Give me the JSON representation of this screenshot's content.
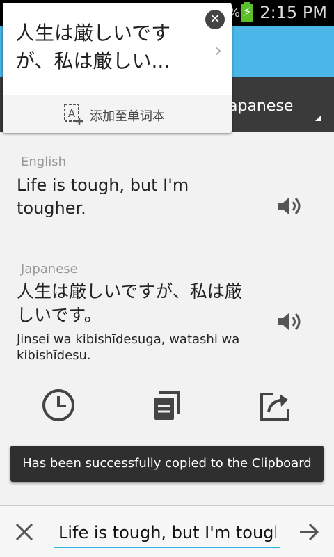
{
  "status_bar": {
    "battery_pct": "%",
    "time": "2:15 PM"
  },
  "popup": {
    "text": "人生は厳しいですが、私は厳しい...",
    "add_to_wordbook": "添加至单词本"
  },
  "language_selector": {
    "target_language": "apanese"
  },
  "source": {
    "label": "English",
    "text": "Life is tough, but I'm tougher."
  },
  "translation": {
    "label": "Japanese",
    "text": "人生は厳しいですが、私は厳しいです。",
    "romanization": "Jinsei wa kibishīdesuga, watashi wa kibishīdesu."
  },
  "toast": {
    "message": "Has been successfully copied to the Clipboard"
  },
  "input": {
    "value": "Life is tough, but I'm tougher."
  },
  "colors": {
    "accent": "#33b5e5",
    "app_bar": "#4bb6e8",
    "battery": "#5bbf2a"
  }
}
